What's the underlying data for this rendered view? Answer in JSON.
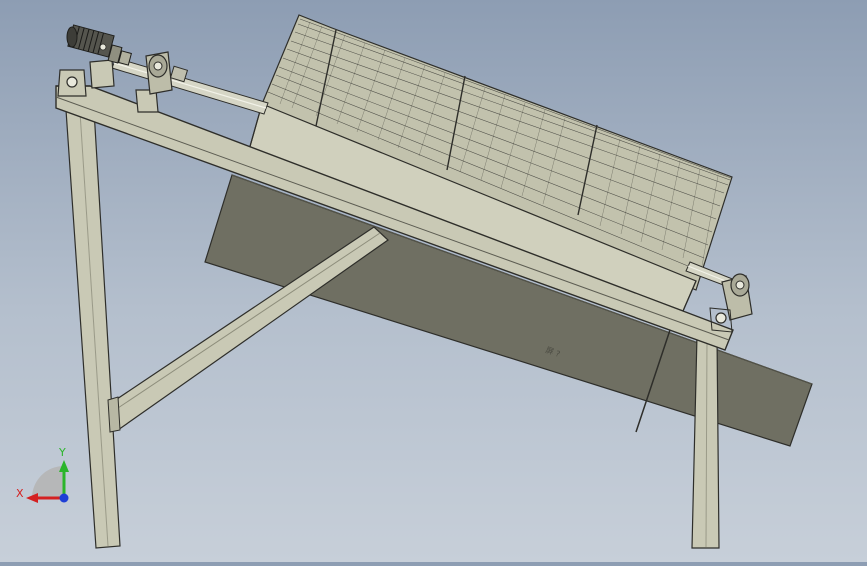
{
  "viewport": {
    "background_top": "#8d9db3",
    "background_bottom": "#c7cfd9"
  },
  "model": {
    "steel_color": "#c9c9b5",
    "steel_edge": "#2e2e2a",
    "hopper_color": "#6f6f62",
    "screen_color": "#c2c2ad",
    "mesh_color": "#3a3a36"
  },
  "hopper_label": "屏 ?",
  "triad": {
    "x_label": "X",
    "y_label": "Y",
    "x_color": "#d42020",
    "y_color": "#2bb52b",
    "z_color": "#1f3fd6"
  }
}
